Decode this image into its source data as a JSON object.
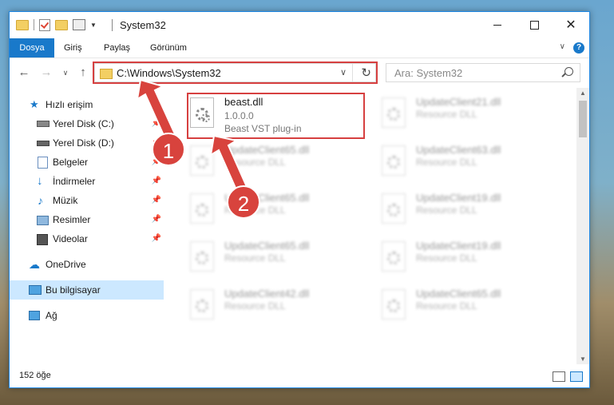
{
  "window": {
    "title": "System32",
    "controls": {
      "minimize": "minimize",
      "maximize": "maximize",
      "close": "✕"
    }
  },
  "ribbon": {
    "tabs": [
      "Dosya",
      "Giriş",
      "Paylaş",
      "Görünüm"
    ],
    "help": "?"
  },
  "address": {
    "path": "C:\\Windows\\System32",
    "search_placeholder": "Ara: System32"
  },
  "sidebar": {
    "quick_access": "Hızlı erişim",
    "items": [
      {
        "label": "Yerel Disk (C:)",
        "icon": "drive-icon",
        "pinned": true
      },
      {
        "label": "Yerel Disk (D:)",
        "icon": "drive-icon",
        "pinned": true
      },
      {
        "label": "Belgeler",
        "icon": "documents-icon",
        "pinned": true
      },
      {
        "label": "İndirmeler",
        "icon": "download-icon",
        "pinned": true
      },
      {
        "label": "Müzik",
        "icon": "music-icon",
        "pinned": true
      },
      {
        "label": "Resimler",
        "icon": "pictures-icon",
        "pinned": true
      },
      {
        "label": "Videolar",
        "icon": "video-icon",
        "pinned": true
      }
    ],
    "onedrive": "OneDrive",
    "this_pc": "Bu bilgisayar",
    "network": "Ağ"
  },
  "files": [
    {
      "name": "beast.dll",
      "version": "1.0.0.0",
      "desc": "Beast VST plug-in",
      "highlighted": true
    },
    {
      "name": "UpdateClient21.dll",
      "desc": "Resource DLL"
    },
    {
      "name": "UpdateClient65.dll",
      "desc": "Resource DLL"
    },
    {
      "name": "UpdateClient63.dll",
      "desc": "Resource DLL"
    },
    {
      "name": "UpdateClient65.dll",
      "desc": "Resource DLL"
    },
    {
      "name": "UpdateClient19.dll",
      "desc": "Resource DLL"
    },
    {
      "name": "UpdateClient65.dll",
      "desc": "Resource DLL"
    },
    {
      "name": "UpdateClient19.dll",
      "desc": "Resource DLL"
    },
    {
      "name": "UpdateClient42.dll",
      "desc": "Resource DLL"
    },
    {
      "name": "UpdateClient65.dll",
      "desc": "Resource DLL"
    }
  ],
  "status": {
    "count": "152 öğe"
  },
  "annotations": [
    "1",
    "2"
  ],
  "colors": {
    "accent": "#1979ca",
    "highlight": "#d64040",
    "callout": "#d8433d"
  }
}
